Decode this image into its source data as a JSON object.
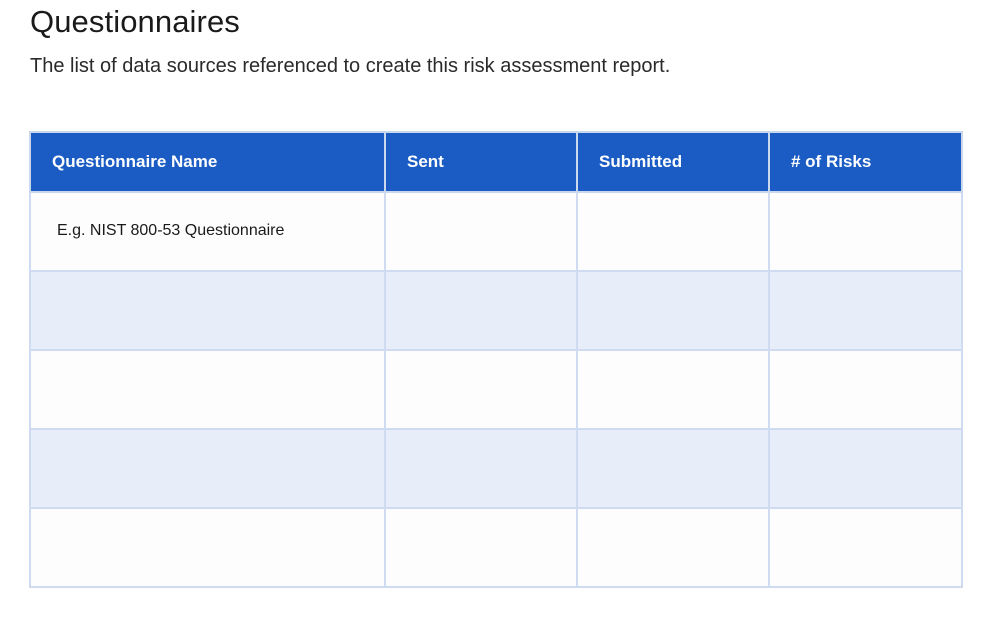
{
  "page": {
    "title": "Questionnaires",
    "subtitle": "The list of data sources referenced to create this risk assessment report."
  },
  "table": {
    "headers": [
      "Questionnaire Name",
      "Sent",
      "Submitted",
      "# of Risks"
    ],
    "rows": [
      [
        "E.g. NIST 800-53 Questionnaire",
        "",
        "",
        ""
      ],
      [
        "",
        "",
        "",
        ""
      ],
      [
        "",
        "",
        "",
        ""
      ],
      [
        "",
        "",
        "",
        ""
      ],
      [
        "",
        "",
        "",
        ""
      ]
    ]
  },
  "colors": {
    "header_background": "#1a5bc4",
    "header_text": "#ffffff",
    "row_alt_background": "#e8eef9",
    "row_background": "#fdfdfd",
    "grid_line": "#cfdbf1"
  }
}
